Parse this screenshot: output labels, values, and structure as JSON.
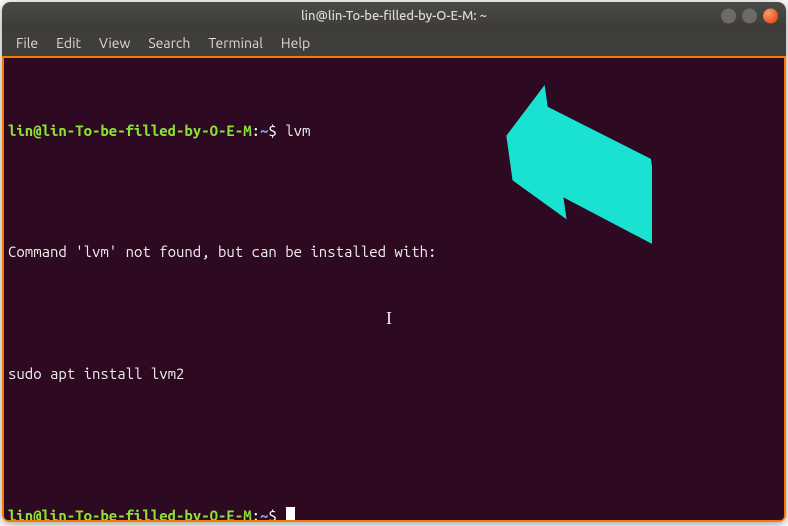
{
  "titlebar": {
    "title": "lin@lin-To-be-filled-by-O-E-M: ~"
  },
  "menubar": {
    "items": [
      "File",
      "Edit",
      "View",
      "Search",
      "Terminal",
      "Help"
    ]
  },
  "terminal": {
    "lines": [
      {
        "type": "prompt",
        "user_host": "lin@lin-To-be-filled-by-O-E-M",
        "sep": ":",
        "path": "~",
        "dollar": "$ ",
        "cmd": "lvm"
      },
      {
        "type": "blank",
        "text": ""
      },
      {
        "type": "output",
        "text": "Command 'lvm' not found, but can be installed with:"
      },
      {
        "type": "blank",
        "text": ""
      },
      {
        "type": "output",
        "text": "sudo apt install lvm2"
      },
      {
        "type": "blank",
        "text": ""
      },
      {
        "type": "prompt",
        "user_host": "lin@lin-To-be-filled-by-O-E-M",
        "sep": ":",
        "path": "~",
        "dollar": "$ ",
        "cmd": "",
        "cursor": true
      }
    ]
  },
  "annotations": {
    "arrow_color": "#19e3d0"
  }
}
